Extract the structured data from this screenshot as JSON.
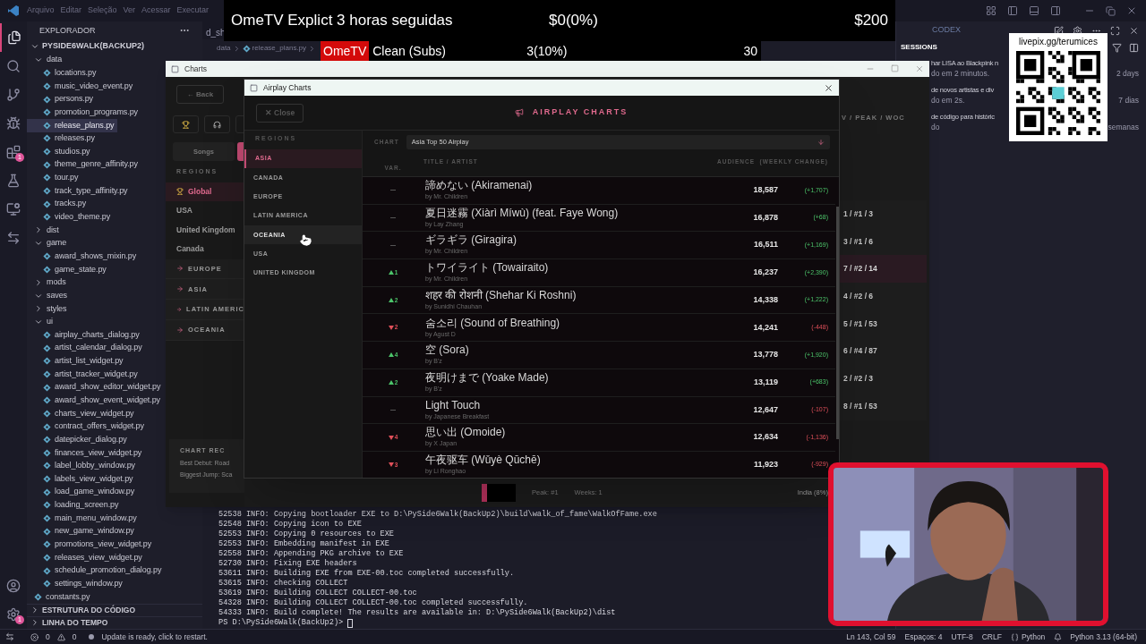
{
  "menu": [
    "Arquivo",
    "Editar",
    "Seleção",
    "Ver",
    "Acessar",
    "Executar"
  ],
  "activity_badges": {
    "extensions": "1",
    "settings": "1"
  },
  "explorer": {
    "title": "EXPLORADOR",
    "project": "PYSIDE6WALK(BACKUP2)",
    "tree": [
      {
        "label": "data",
        "kind": "folder",
        "expanded": true,
        "selected": false,
        "children": [
          {
            "label": "locations.py",
            "kind": "file",
            "selected": false
          },
          {
            "label": "music_video_event.py",
            "kind": "file",
            "selected": false
          },
          {
            "label": "persons.py",
            "kind": "file",
            "selected": false
          },
          {
            "label": "promotion_programs.py",
            "kind": "file",
            "selected": false
          },
          {
            "label": "release_plans.py",
            "kind": "file",
            "selected": true
          },
          {
            "label": "releases.py",
            "kind": "file",
            "selected": false
          },
          {
            "label": "studios.py",
            "kind": "file",
            "selected": false
          },
          {
            "label": "theme_genre_affinity.py",
            "kind": "file",
            "selected": false
          },
          {
            "label": "tour.py",
            "kind": "file",
            "selected": false
          },
          {
            "label": "track_type_affinity.py",
            "kind": "file",
            "selected": false
          },
          {
            "label": "tracks.py",
            "kind": "file",
            "selected": false
          },
          {
            "label": "video_theme.py",
            "kind": "file",
            "selected": false
          }
        ]
      },
      {
        "label": "dist",
        "kind": "folder",
        "expanded": false,
        "selected": false
      },
      {
        "label": "game",
        "kind": "folder",
        "expanded": true,
        "selected": false,
        "children": [
          {
            "label": "award_shows_mixin.py",
            "kind": "file",
            "selected": false
          },
          {
            "label": "game_state.py",
            "kind": "file",
            "selected": false
          }
        ]
      },
      {
        "label": "mods",
        "kind": "folder",
        "expanded": false,
        "selected": false
      },
      {
        "label": "saves",
        "kind": "folder",
        "expanded": true,
        "selected": false
      },
      {
        "label": "styles",
        "kind": "folder",
        "expanded": false,
        "selected": false
      },
      {
        "label": "ui",
        "kind": "folder",
        "expanded": true,
        "selected": false,
        "children": [
          {
            "label": "airplay_charts_dialog.py",
            "kind": "file",
            "selected": false
          },
          {
            "label": "artist_calendar_dialog.py",
            "kind": "file",
            "selected": false
          },
          {
            "label": "artist_list_widget.py",
            "kind": "file",
            "selected": false
          },
          {
            "label": "artist_tracker_widget.py",
            "kind": "file",
            "selected": false
          },
          {
            "label": "award_show_editor_widget.py",
            "kind": "file",
            "selected": false
          },
          {
            "label": "award_show_event_widget.py",
            "kind": "file",
            "selected": false
          },
          {
            "label": "charts_view_widget.py",
            "kind": "file",
            "selected": false
          },
          {
            "label": "contract_offers_widget.py",
            "kind": "file",
            "selected": false
          },
          {
            "label": "datepicker_dialog.py",
            "kind": "file",
            "selected": false
          },
          {
            "label": "finances_view_widget.py",
            "kind": "file",
            "selected": false
          },
          {
            "label": "label_lobby_window.py",
            "kind": "file",
            "selected": false
          },
          {
            "label": "labels_view_widget.py",
            "kind": "file",
            "selected": false
          },
          {
            "label": "load_game_window.py",
            "kind": "file",
            "selected": false
          },
          {
            "label": "loading_screen.py",
            "kind": "file",
            "selected": false
          },
          {
            "label": "main_menu_window.py",
            "kind": "file",
            "selected": false
          },
          {
            "label": "new_game_window.py",
            "kind": "file",
            "selected": false
          },
          {
            "label": "promotions_view_widget.py",
            "kind": "file",
            "selected": false
          },
          {
            "label": "releases_view_widget.py",
            "kind": "file",
            "selected": false
          },
          {
            "label": "schedule_promotion_dialog.py",
            "kind": "file",
            "selected": false
          },
          {
            "label": "settings_window.py",
            "kind": "file",
            "selected": false
          }
        ]
      },
      {
        "label": "constants.py",
        "kind": "file",
        "selected": false
      }
    ],
    "sections": [
      "ESTRUTURA DO CÓDIGO",
      "LINHA DO TEMPO"
    ]
  },
  "editor": {
    "tab": "d_sh",
    "breadcrumb": [
      "data",
      "release_plans.py"
    ]
  },
  "stream_overlay": {
    "title": "OmeTV Explict 3 horas seguidas",
    "progress": "$0(0%)",
    "goal": "$200",
    "badge": "OmeTV",
    "sub_label": "Clean (Subs)",
    "sub_progress": "3(10%)",
    "sub_goal": "30"
  },
  "charts_window": {
    "title": "Charts",
    "back": "← Back",
    "tab": "Songs",
    "regions_title": "REGIONS",
    "regions": [
      {
        "label": "Global",
        "kind": "global",
        "selected": true
      },
      {
        "label": "USA",
        "kind": "country",
        "selected": false
      },
      {
        "label": "United Kingdom",
        "kind": "country",
        "selected": false
      },
      {
        "label": "Canada",
        "kind": "country",
        "selected": false
      },
      {
        "label": "EUROPE",
        "kind": "group",
        "selected": false
      },
      {
        "label": "ASIA",
        "kind": "group",
        "selected": false
      },
      {
        "label": "LATIN AMERIC",
        "kind": "group",
        "selected": false
      },
      {
        "label": "OCEANIA",
        "kind": "group",
        "selected": false
      }
    ],
    "records_title": "CHART REC",
    "records": [
      "Best Debut: Road",
      "Biggest Jump: Sca"
    ],
    "stats_header": "V / PEAK / WOC",
    "stats": [
      {
        "text": "1 / #1 / 3",
        "selected": false
      },
      {
        "text": "3 / #1 / 6",
        "selected": false
      },
      {
        "text": "7 / #2 / 14",
        "selected": true
      },
      {
        "text": "4 / #2 / 6",
        "selected": false
      },
      {
        "text": "5 / #1 / 53",
        "selected": false
      },
      {
        "text": "6 / #4 / 87",
        "selected": false
      },
      {
        "text": "2 / #2 / 3",
        "selected": false
      },
      {
        "text": "8 / #1 / 53",
        "selected": false
      }
    ],
    "footer": {
      "peak": "Peak: #1",
      "weeks": "Weeks: 1",
      "market": "India (8%)"
    }
  },
  "airplay_dialog": {
    "title": "Airplay Charts",
    "close": "✕ Close",
    "heading": "AIRPLAY CHARTS",
    "regions_title": "REGIONS",
    "regions": [
      {
        "label": "ASIA",
        "selected": true,
        "hovered": false
      },
      {
        "label": "CANADA",
        "selected": false,
        "hovered": false
      },
      {
        "label": "EUROPE",
        "selected": false,
        "hovered": false
      },
      {
        "label": "LATIN AMERICA",
        "selected": false,
        "hovered": false
      },
      {
        "label": "OCEANIA",
        "selected": false,
        "hovered": true
      },
      {
        "label": "USA",
        "selected": false,
        "hovered": false
      },
      {
        "label": "UNITED KINGDOM",
        "selected": false,
        "hovered": false
      }
    ],
    "chart_label": "CHART",
    "chart_value": "Asia Top 50 Airplay",
    "columns": [
      "VAR.",
      "TITLE / ARTIST",
      "AUDIENCE  (WEEKLY CHANGE)"
    ],
    "rows": [
      {
        "var": {
          "kind": "same"
        },
        "title": "諦めない (Akiramenai)",
        "artist": "by Mr. Children",
        "audience": "18,587",
        "change": {
          "text": "(+1,707)",
          "kind": "gain"
        }
      },
      {
        "var": {
          "kind": "same"
        },
        "title": "夏日迷霧 (Xiàrì Míwù) (feat. Faye Wong)",
        "artist": "by Lay Zhang",
        "audience": "16,878",
        "change": {
          "text": "(+68)",
          "kind": "gain"
        }
      },
      {
        "var": {
          "kind": "same"
        },
        "title": "ギラギラ (Giragira)",
        "artist": "by Mr. Children",
        "audience": "16,511",
        "change": {
          "text": "(+1,169)",
          "kind": "gain"
        }
      },
      {
        "var": {
          "kind": "up",
          "text": "1"
        },
        "title": "トワイライト (Towairaito)",
        "artist": "by Mr. Children",
        "audience": "16,237",
        "change": {
          "text": "(+2,390)",
          "kind": "gain"
        }
      },
      {
        "var": {
          "kind": "up",
          "text": "2"
        },
        "title": "शहर की रोशनी (Shehar Ki Roshni)",
        "artist": "by Sunidhi Chauhan",
        "audience": "14,338",
        "change": {
          "text": "(+1,222)",
          "kind": "gain"
        }
      },
      {
        "var": {
          "kind": "down",
          "text": "2"
        },
        "title": "숨소리 (Sound of Breathing)",
        "artist": "by Agust D",
        "audience": "14,241",
        "change": {
          "text": "(-448)",
          "kind": "loss"
        }
      },
      {
        "var": {
          "kind": "up",
          "text": "4"
        },
        "title": "空 (Sora)",
        "artist": "by B'z",
        "audience": "13,778",
        "change": {
          "text": "(+1,920)",
          "kind": "gain"
        }
      },
      {
        "var": {
          "kind": "up",
          "text": "2"
        },
        "title": "夜明けまで (Yoake Made)",
        "artist": "by B'z",
        "audience": "13,119",
        "change": {
          "text": "(+683)",
          "kind": "gain"
        }
      },
      {
        "var": {
          "kind": "same"
        },
        "title": "Light Touch",
        "artist": "by Japanese Breakfast",
        "audience": "12,647",
        "change": {
          "text": "(-107)",
          "kind": "loss"
        }
      },
      {
        "var": {
          "kind": "down",
          "text": "4"
        },
        "title": "思い出 (Omoide)",
        "artist": "by X Japan",
        "audience": "12,634",
        "change": {
          "text": "(-1,136)",
          "kind": "loss"
        }
      },
      {
        "var": {
          "kind": "down",
          "text": "3"
        },
        "title": "午夜驱车 (Wǔyè Qūchē)",
        "artist": "by Li Ronghao",
        "audience": "11,923",
        "change": {
          "text": "(-929)",
          "kind": "loss"
        }
      }
    ]
  },
  "terminal": [
    "52538 INFO: Copying bootloader EXE to D:\\PySide6Walk(BackUp2)\\build\\walk_of_fame\\WalkOfFame.exe",
    "52548 INFO: Copying icon to EXE",
    "52553 INFO: Copying 0 resources to EXE",
    "52553 INFO: Embedding manifest in EXE",
    "52558 INFO: Appending PKG archive to EXE",
    "52730 INFO: Fixing EXE headers",
    "53611 INFO: Building EXE from EXE-00.toc completed successfully.",
    "53615 INFO: checking COLLECT",
    "53619 INFO: Building COLLECT COLLECT-00.toc",
    "54328 INFO: Building COLLECT COLLECT-00.toc completed successfully.",
    "54333 INFO: Build complete! The results are available in: D:\\PySide6Walk(BackUp2)\\dist",
    "PS D:\\PySide6Walk(BackUp2)> "
  ],
  "codex": {
    "title": "CODEX",
    "sessions_title": "SESSIONS",
    "sessions": [
      {
        "title": "har LISA ao Blackpink n",
        "subtitle": "do em 2 minutos.",
        "time": "2 days"
      },
      {
        "title": "de novos artistas e div",
        "subtitle": "do em 2s.",
        "time": "7 dias"
      },
      {
        "title": "de código para históric",
        "subtitle": "do",
        "time": "semanas"
      }
    ]
  },
  "qr": {
    "caption": "livepix.gg/terumices"
  },
  "status_bar": {
    "errors": "0",
    "warnings": "0",
    "message": "Update is ready, click to restart.",
    "right": [
      "Ln 143, Col 59",
      "Espaços: 4",
      "UTF-8",
      "CRLF",
      "Python",
      "Python 3.13 (64-bit)"
    ]
  }
}
